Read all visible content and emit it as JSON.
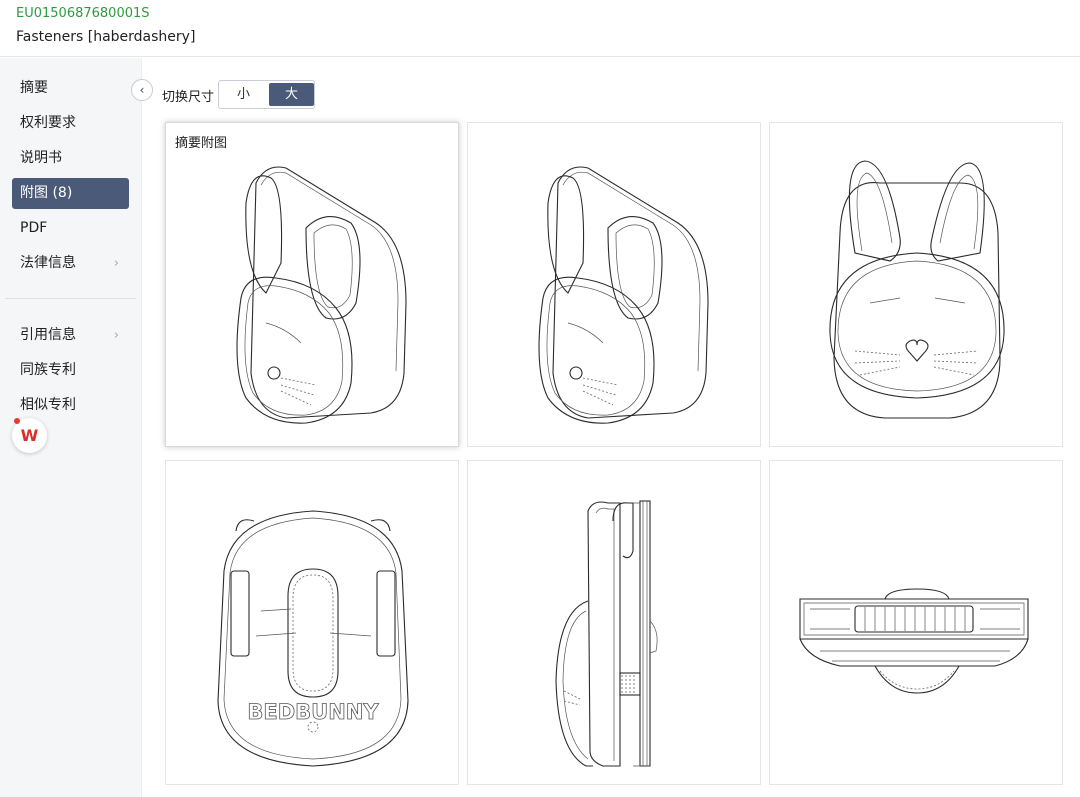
{
  "header": {
    "publication_number": "EU0150687680001S",
    "title": "Fasteners [haberdashery]"
  },
  "colors": {
    "publication_number": "#2f9a3f",
    "nav_active_bg": "#4b5a78",
    "sidebar_bg": "#f5f6f8"
  },
  "sidebar": {
    "items": [
      {
        "label": "摘要"
      },
      {
        "label": "权利要求"
      },
      {
        "label": "说明书"
      },
      {
        "label": "附图 (8)",
        "active": true
      },
      {
        "label": "PDF"
      },
      {
        "label": "法律信息",
        "chevron": "›"
      },
      {
        "label": "引用信息",
        "chevron": "›"
      },
      {
        "label": "同族专利"
      },
      {
        "label": "相似专利"
      }
    ],
    "collapse_icon": "‹",
    "wps_badge": "W"
  },
  "toolbar": {
    "size_label": "切换尺寸",
    "size_options": [
      "小",
      "大"
    ],
    "selected_size": "大"
  },
  "figures": {
    "items": [
      {
        "caption": "摘要附图",
        "icon": "bunny-perspective-drawing",
        "selected": true
      },
      {
        "caption": "",
        "icon": "bunny-perspective-drawing"
      },
      {
        "caption": "",
        "icon": "bunny-front-view-drawing"
      },
      {
        "caption": "",
        "icon": "bunny-back-view-drawing",
        "printed_text": "BEDBUNNY"
      },
      {
        "caption": "",
        "icon": "bunny-side-view-drawing"
      },
      {
        "caption": "",
        "icon": "bunny-top-view-drawing"
      }
    ]
  }
}
